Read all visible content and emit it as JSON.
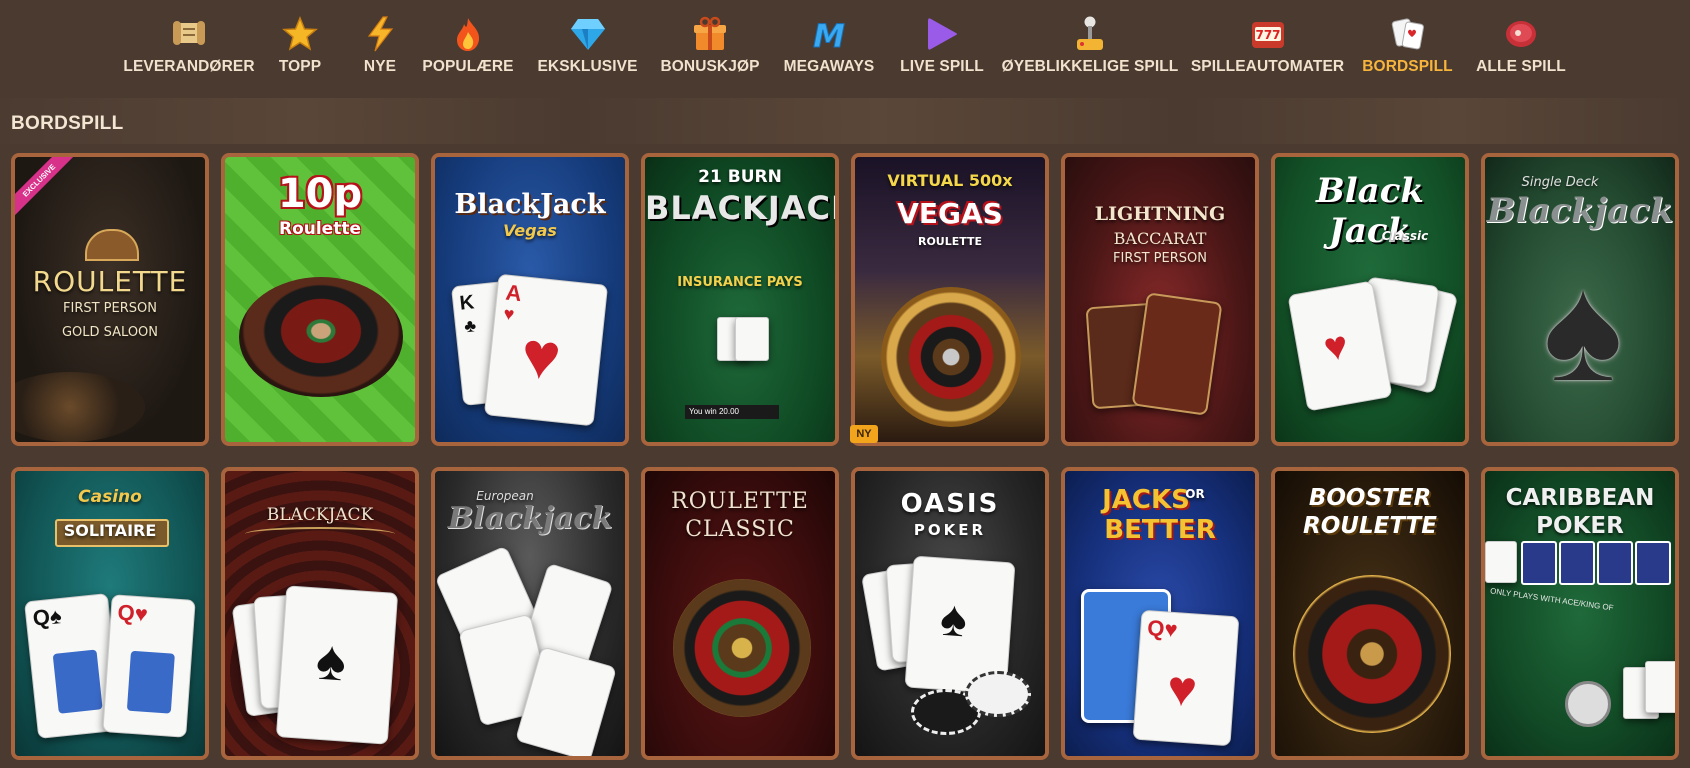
{
  "nav": {
    "items": [
      {
        "label": "LEVERANDØRER",
        "icon": "scroll-icon"
      },
      {
        "label": "TOPP",
        "icon": "star-icon"
      },
      {
        "label": "NYE",
        "icon": "lightning-icon"
      },
      {
        "label": "POPULÆRE",
        "icon": "fire-icon"
      },
      {
        "label": "EKSKLUSIVE",
        "icon": "diamond-icon"
      },
      {
        "label": "BONUSKJØP",
        "icon": "gift-icon"
      },
      {
        "label": "MEGAWAYS",
        "icon": "m-letter-icon"
      },
      {
        "label": "LIVE SPILL",
        "icon": "play-icon"
      },
      {
        "label": "ØYEBLIKKELIGE SPILL",
        "icon": "joystick-icon"
      },
      {
        "label": "SPILLEAUTOMATER",
        "icon": "slot-machine-icon"
      },
      {
        "label": "BORDSPILL",
        "icon": "playing-cards-icon"
      },
      {
        "label": "ALLE SPILL",
        "icon": "meat-icon"
      }
    ],
    "active": "BORDSPILL"
  },
  "section_title": "BORDSPILL",
  "games": [
    {
      "title": "ROULETTE",
      "sub1": "FIRST PERSON",
      "sub2": "GOLD SALOON",
      "badge": "EXCLUSIVE"
    },
    {
      "title": "10p",
      "sub1": "Roulette"
    },
    {
      "title": "BlackJack",
      "sub1": "Vegas"
    },
    {
      "title": "BLACKJACK",
      "sub1": "21 BURN",
      "sub2": "INSURANCE PAYS",
      "extra": "You win 20.00"
    },
    {
      "title": "VEGAS",
      "sub1": "VIRTUAL 500x",
      "sub2": "ROULETTE",
      "badge": "NY"
    },
    {
      "title": "LIGHTNING",
      "sub1": "BACCARAT",
      "sub2": "FIRST PERSON"
    },
    {
      "title": "Black Jack",
      "sub1": "Classic"
    },
    {
      "title": "Blackjack",
      "sub1": "Single Deck"
    },
    {
      "title": "SOLITAIRE",
      "sub1": "Casino"
    },
    {
      "title": "BLACKJACK"
    },
    {
      "title": "Blackjack",
      "sub1": "European"
    },
    {
      "title": "ROULETTE",
      "sub1": "CLASSIC"
    },
    {
      "title": "OASIS",
      "sub1": "POKER"
    },
    {
      "title": "JACKS",
      "sub1": "OR",
      "sub2": "BETTER"
    },
    {
      "title": "BOOSTER",
      "sub1": "ROULETTE"
    },
    {
      "title": "CARIBBEAN",
      "sub1": "POKER",
      "sub2": "ONLY PLAYS WITH ACE/KING OF"
    }
  ]
}
